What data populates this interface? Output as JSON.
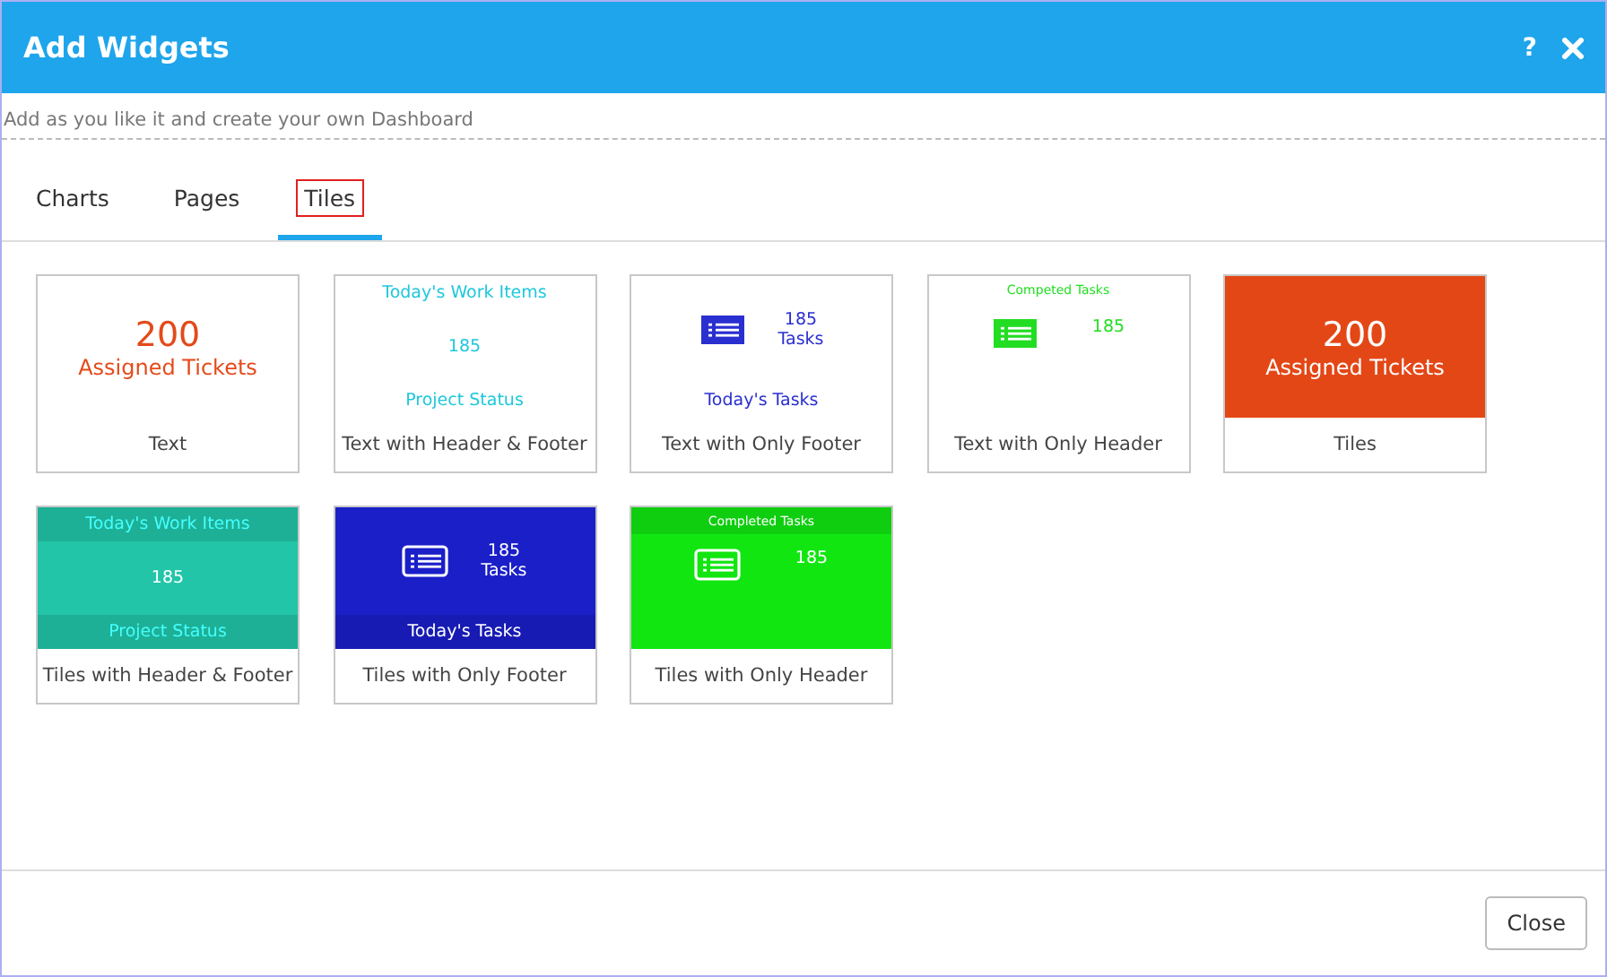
{
  "window": {
    "title": "Add Widgets",
    "help": "?"
  },
  "subtitle": "Add as you like it and create your own Dashboard",
  "tabs": [
    {
      "label": "Charts",
      "selected": false
    },
    {
      "label": "Pages",
      "selected": false
    },
    {
      "label": "Tiles",
      "selected": true
    }
  ],
  "widgets": [
    {
      "label": "Text",
      "kind": "text_number",
      "color": "#e44a1a",
      "value": "200",
      "caption": "Assigned Tickets"
    },
    {
      "label": "Text with Header & Footer",
      "kind": "text_header_footer",
      "color": "#1fc8dc",
      "header": "Today's Work Items",
      "value": "185",
      "footer": "Project Status"
    },
    {
      "label": "Text with Only Footer",
      "kind": "text_footer",
      "color": "#2a2fd0",
      "value": "185",
      "caption": "Tasks",
      "footer": "Today's Tasks"
    },
    {
      "label": "Text with Only Header",
      "kind": "text_header",
      "color": "#22dd22",
      "header": "Competed Tasks",
      "value": "185"
    },
    {
      "label": "Tiles",
      "kind": "tile_number",
      "color": "#e44716",
      "value": "200",
      "caption": "Assigned Tickets"
    },
    {
      "label": "Tiles with Header & Footer",
      "kind": "tile_header_footer",
      "color": "#22c5a8",
      "header": "Today's Work Items",
      "value": "185",
      "footer": "Project Status"
    },
    {
      "label": "Tiles with Only Footer",
      "kind": "tile_footer",
      "color": "#1a1fc8",
      "value": "185",
      "caption": "Tasks",
      "footer": "Today's Tasks"
    },
    {
      "label": "Tiles with Only Header",
      "kind": "tile_header",
      "color": "#11e611",
      "header": "Completed Tasks",
      "value": "185"
    }
  ],
  "footer": {
    "button": "Close"
  }
}
